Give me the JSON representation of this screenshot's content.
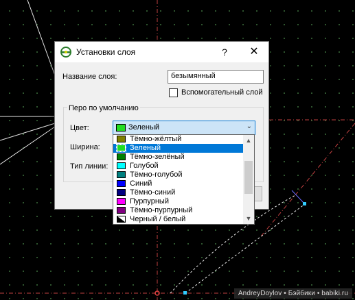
{
  "dialog": {
    "title": "Установки слоя",
    "help_label": "?",
    "close_label": "✕",
    "layer_name_label": "Название слоя:",
    "layer_name_value": "безымянный",
    "auxiliary_label": "Вспомогательный слой",
    "auxiliary_checked": false,
    "pen_group_title": "Перо по умолчанию",
    "color_label": "Цвет:",
    "width_label": "Ширина:",
    "linetype_label": "Тип линии:",
    "color_value": "Зеленый",
    "color_value_hex": "#22dd22"
  },
  "color_list": [
    {
      "label": "Тёмно-жёлтый",
      "color": "#808000"
    },
    {
      "label": "Зеленый",
      "color": "#22dd22",
      "selected": true
    },
    {
      "label": "Тёмно-зелёный",
      "color": "#008000"
    },
    {
      "label": "Голубой",
      "color": "#00ffff"
    },
    {
      "label": "Тёмно-голубой",
      "color": "#008080"
    },
    {
      "label": "Синий",
      "color": "#0000ff"
    },
    {
      "label": "Тёмно-синий",
      "color": "#000080"
    },
    {
      "label": "Пурпурный",
      "color": "#ff00ff"
    },
    {
      "label": "Тёмно-пурпурный",
      "color": "#800080"
    },
    {
      "label": "Черный / белый",
      "color": "black-white"
    }
  ],
  "watermark": "AndreyDoylov • Бэйбики • babiki.ru",
  "colors": {
    "accent": "#0078d7",
    "combo_bg": "#cce4f7",
    "canvas_bg": "#000000"
  },
  "icons": {
    "app": "layer-icon",
    "dropdown": "chevron-down-icon",
    "scroll_up": "chevron-up-icon",
    "scroll_down": "chevron-down-icon"
  }
}
